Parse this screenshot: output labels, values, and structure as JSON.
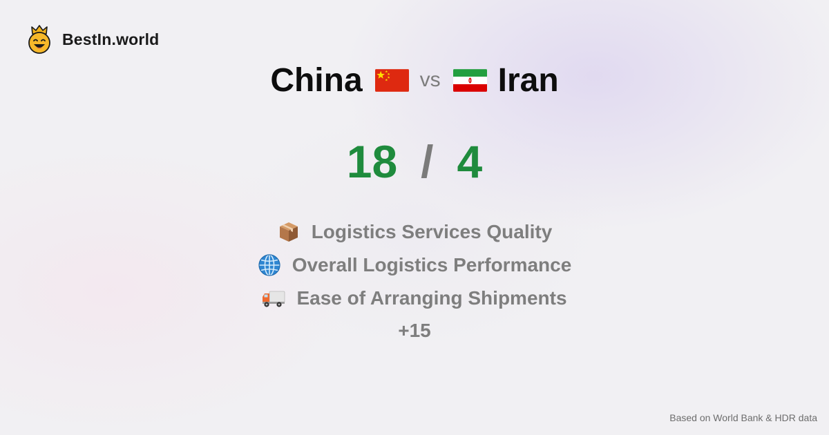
{
  "brand": {
    "logo_icon": "crowned-smiley-icon",
    "name": "BestIn.world"
  },
  "comparison": {
    "country_a": "China",
    "country_a_flag": "china-flag-icon",
    "vs_label": "vs",
    "country_b": "Iran",
    "country_b_flag": "iran-flag-icon"
  },
  "score": {
    "a": "18",
    "separator": "/",
    "b": "4",
    "color": "#1f8b3d"
  },
  "metrics": [
    {
      "icon": "package-icon",
      "label": "Logistics Services Quality"
    },
    {
      "icon": "globe-icon",
      "label": "Overall Logistics Performance"
    },
    {
      "icon": "delivery-truck-icon",
      "label": "Ease of Arranging Shipments"
    }
  ],
  "more_label": "+15",
  "footer": {
    "source": "Based on World Bank & HDR data"
  }
}
